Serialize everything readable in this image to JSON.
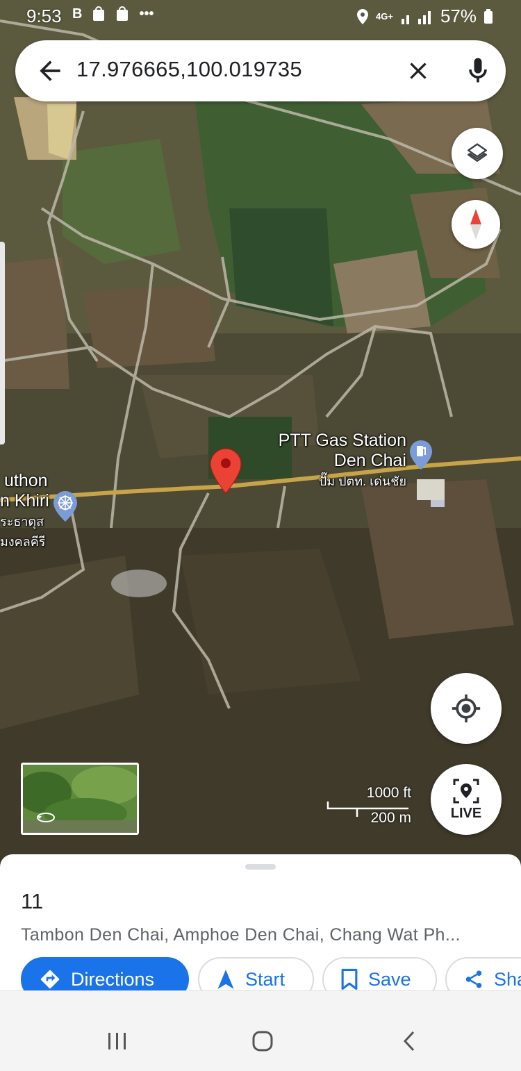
{
  "status_bar": {
    "time": "9:53",
    "notification_icons": [
      "B",
      "shop-bag-icon",
      "shop-bag-icon",
      "more-dots-icon"
    ],
    "network": "4G+",
    "battery": "57%"
  },
  "search": {
    "query": "17.976665,100.019735",
    "back_icon": "arrow-back-icon",
    "clear_icon": "close-icon",
    "mic_icon": "microphone-icon"
  },
  "map": {
    "layers_icon": "layers-icon",
    "compass_icon": "compass-icon",
    "my_location_icon": "my-location-icon",
    "live_label": "LIVE",
    "places": {
      "gas_station": {
        "line1": "PTT Gas Station",
        "line2": "Den Chai",
        "thai": "ปั๊ม ปตท. เด่นชัย"
      },
      "temple": {
        "line1": "uthon",
        "line2": "n Khiri",
        "thai1": "ระธาตุส",
        "thai2": "มงคลคีรี"
      }
    },
    "scale": {
      "imperial": "1000 ft",
      "metric": "200 m"
    }
  },
  "sheet": {
    "title": "11",
    "address": "Tambon Den Chai, Amphoe Den Chai, Chang Wat Ph...",
    "actions": {
      "directions": "Directions",
      "start": "Start",
      "save": "Save",
      "share": "Sha"
    }
  },
  "colors": {
    "accent": "#1a73e8",
    "pin": "#ea4335",
    "road": "#c7a449"
  }
}
